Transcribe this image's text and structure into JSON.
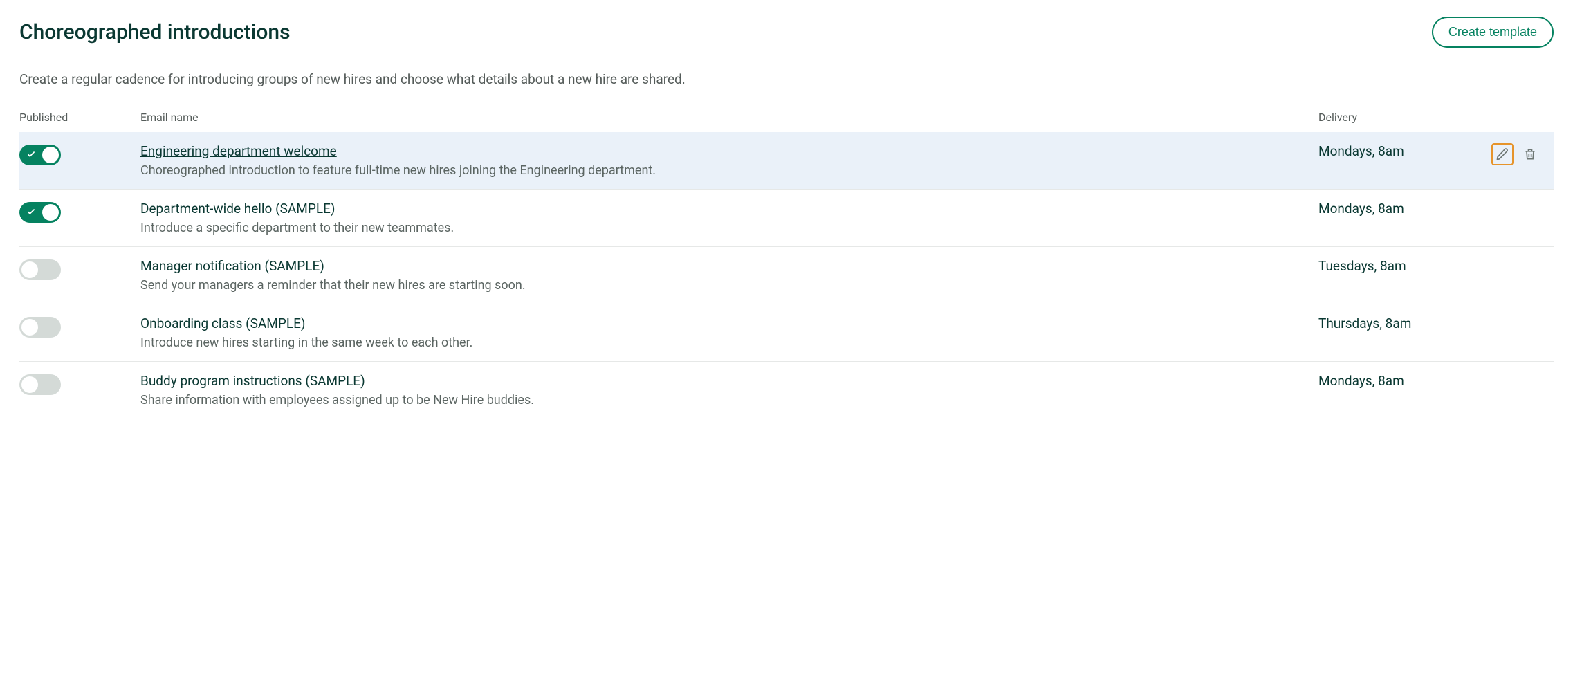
{
  "header": {
    "title": "Choreographed introductions",
    "create_button": "Create template"
  },
  "subtitle": "Create a regular cadence for introducing groups of new hires and choose what details about a new hire are shared.",
  "columns": {
    "published": "Published",
    "email_name": "Email name",
    "delivery": "Delivery"
  },
  "rows": [
    {
      "published": true,
      "highlighted": true,
      "name": "Engineering department welcome",
      "name_linked": true,
      "description": "Choreographed introduction to feature full-time new hires joining the Engineering department.",
      "delivery": "Mondays, 8am",
      "show_actions": true
    },
    {
      "published": true,
      "highlighted": false,
      "name": "Department-wide hello (SAMPLE)",
      "name_linked": false,
      "description": "Introduce a specific department to their new teammates.",
      "delivery": "Mondays, 8am",
      "show_actions": false
    },
    {
      "published": false,
      "highlighted": false,
      "name": "Manager notification (SAMPLE)",
      "name_linked": false,
      "description": "Send your managers a reminder that their new hires are starting soon.",
      "delivery": "Tuesdays, 8am",
      "show_actions": false
    },
    {
      "published": false,
      "highlighted": false,
      "name": "Onboarding class (SAMPLE)",
      "name_linked": false,
      "description": "Introduce new hires starting in the same week to each other.",
      "delivery": "Thursdays, 8am",
      "show_actions": false
    },
    {
      "published": false,
      "highlighted": false,
      "name": "Buddy program instructions (SAMPLE)",
      "name_linked": false,
      "description": "Share information with employees assigned up to be New Hire buddies.",
      "delivery": "Mondays, 8am",
      "show_actions": false
    }
  ]
}
